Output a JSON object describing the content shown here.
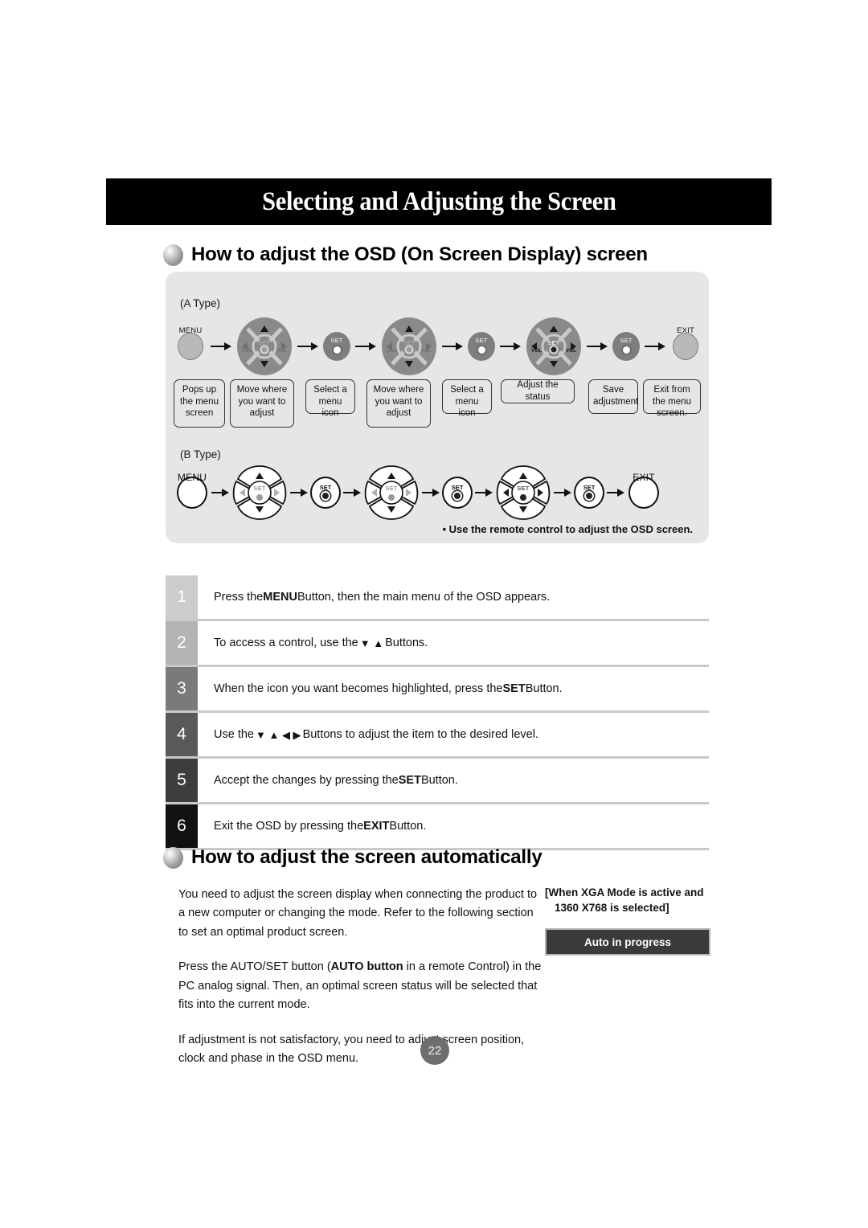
{
  "header": {
    "title": "Selecting and Adjusting the Screen"
  },
  "sections": {
    "osd": {
      "title": "How to adjust the OSD (On Screen Display) screen"
    },
    "auto": {
      "title": "How to adjust the screen automatically"
    }
  },
  "diagram": {
    "type_a_label": "(A Type)",
    "type_b_label": "(B Type)",
    "remote_note": "• Use the remote control to adjust the OSD screen.",
    "button_captions": {
      "menu": "MENU",
      "exit": "EXIT",
      "set": "SET",
      "vol": "VOL"
    },
    "type_a_steps": [
      {
        "caption": "MENU",
        "kind": "round"
      },
      {
        "caption": "",
        "kind": "pad"
      },
      {
        "caption": "",
        "kind": "set"
      },
      {
        "caption": "",
        "kind": "pad"
      },
      {
        "caption": "",
        "kind": "set"
      },
      {
        "caption": "",
        "kind": "pad"
      },
      {
        "caption": "",
        "kind": "set"
      },
      {
        "caption": "EXIT",
        "kind": "round"
      }
    ],
    "labels": [
      "Pops up the menu screen",
      "Move where you want to adjust",
      "Select a menu icon",
      "Move where you want to adjust",
      "Select a menu icon",
      "Adjust the status",
      "Save adjustment",
      "Exit from the menu screen."
    ]
  },
  "steps": [
    {
      "num": "1",
      "bg": "#cccccc",
      "text_before": "Press the ",
      "bold": "MENU",
      "text_after": " Button, then the main menu of the OSD appears."
    },
    {
      "num": "2",
      "bg": "#b3b3b3",
      "text_before": "To access a control, use the ",
      "glyphs": "▼ ▲",
      "text_after": " Buttons."
    },
    {
      "num": "3",
      "bg": "#7a7a7a",
      "text_before": "When the icon you want becomes highlighted, press the ",
      "bold": "SET",
      "text_after": " Button."
    },
    {
      "num": "4",
      "bg": "#595959",
      "text_before": "Use the ",
      "glyphs": "▼ ▲ ◀ ▶",
      "text_after": " Buttons to adjust the item to the desired level."
    },
    {
      "num": "5",
      "bg": "#3d3d3d",
      "text_before": "Accept the changes by pressing the ",
      "bold": "SET",
      "text_after": " Button."
    },
    {
      "num": "6",
      "bg": "#111111",
      "text_before": "Exit the OSD by pressing the ",
      "bold": "EXIT",
      "text_after": " Button."
    }
  ],
  "auto_section": {
    "paragraph_1": "You need to adjust the screen display when connecting the product to a new computer or changing the mode. Refer to the following section to set an optimal product screen.",
    "paragraph_2_a": "Press the AUTO/SET button (",
    "paragraph_2_bold": "AUTO button",
    "paragraph_2_b": " in a remote Control) in the PC analog signal. Then, an optimal screen status will be selected that fits into the current mode.",
    "paragraph_3": "If adjustment is not satisfactory, you need to adjust screen position, clock and phase in the OSD menu.",
    "note_line_1": "[When XGA Mode is active and",
    "note_line_2": "1360 X768 is selected]",
    "auto_button_label": "Auto in progress"
  },
  "footer": {
    "page_number": "22"
  }
}
